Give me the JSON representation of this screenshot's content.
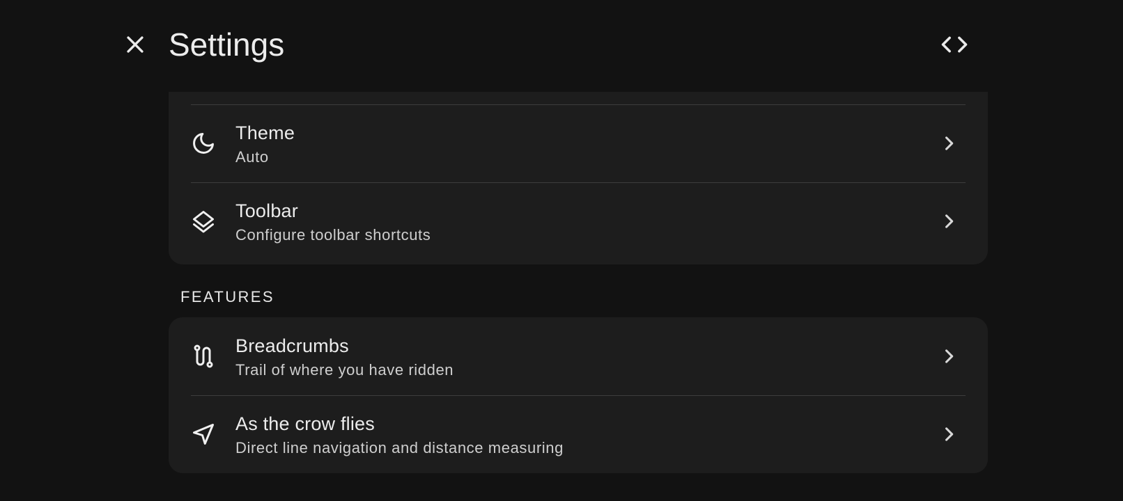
{
  "header": {
    "title": "Settings",
    "close_icon": "close-icon",
    "code_icon": "code-icon"
  },
  "appearance": {
    "items": [
      {
        "title": "Theme",
        "subtitle": "Auto",
        "icon": "moon-icon"
      },
      {
        "title": "Toolbar",
        "subtitle": "Configure toolbar shortcuts",
        "icon": "layers-icon"
      }
    ]
  },
  "features": {
    "label": "FEATURES",
    "items": [
      {
        "title": "Breadcrumbs",
        "subtitle": "Trail of where you have ridden",
        "icon": "route-icon"
      },
      {
        "title": "As the crow flies",
        "subtitle": "Direct line navigation and distance measuring",
        "icon": "navigation-arrow-icon"
      }
    ]
  },
  "colors": {
    "background": "#121212",
    "card": "#1d1d1d",
    "divider": "#3d3d3d",
    "text_primary": "#ececec",
    "text_secondary": "#cfcfcf"
  }
}
